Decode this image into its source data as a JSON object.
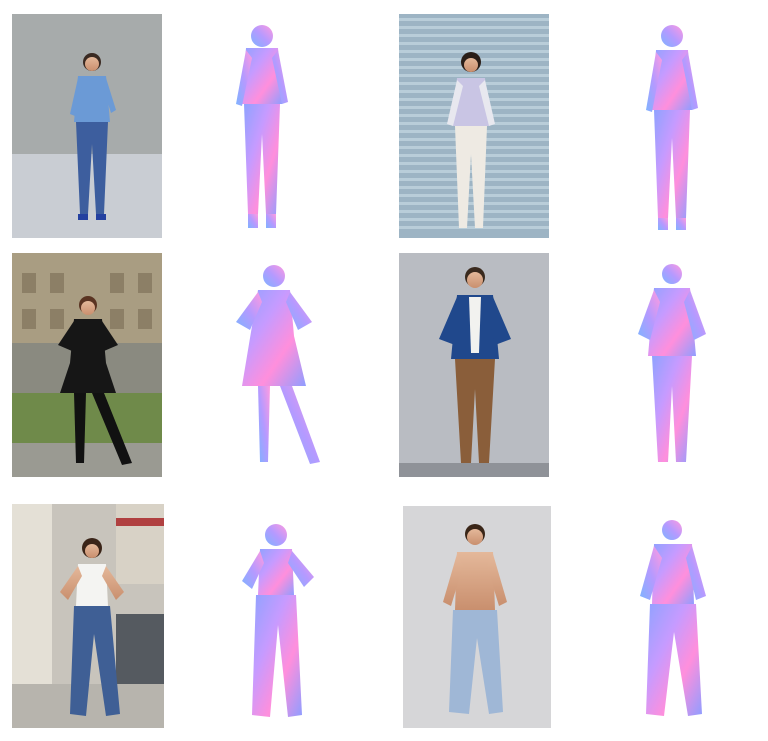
{
  "grid": {
    "rows": [
      {
        "photo_left": {
          "subject": "woman-denim-shirt-jeans",
          "backdrop": "concrete-wall"
        },
        "normal_left": {
          "subject": "woman-standing-normal-map"
        },
        "photo_right": {
          "subject": "woman-white-jacket-white-pants",
          "backdrop": "blue-shutter"
        },
        "normal_right": {
          "subject": "woman-standing-normal-map"
        }
      },
      {
        "photo_left": {
          "subject": "woman-black-dress-boots",
          "backdrop": "city-building"
        },
        "normal_left": {
          "subject": "woman-hands-on-hips-dress-normal-map"
        },
        "photo_right": {
          "subject": "man-blue-blazer-brown-pants",
          "backdrop": "grey-studio"
        },
        "normal_right": {
          "subject": "man-blazer-normal-map"
        }
      },
      {
        "photo_left": {
          "subject": "woman-white-tank-jeans",
          "backdrop": "arcade-street"
        },
        "normal_left": {
          "subject": "woman-hands-on-hips-jeans-normal-map"
        },
        "photo_right": {
          "subject": "man-shirtless-jeans",
          "backdrop": "light-studio"
        },
        "normal_right": {
          "subject": "man-hands-in-pockets-normal-map"
        }
      }
    ]
  },
  "colors": {
    "normal_map_gradient": [
      "#7b8cff",
      "#c58cff",
      "#ff8de0",
      "#8ad0ff"
    ]
  }
}
